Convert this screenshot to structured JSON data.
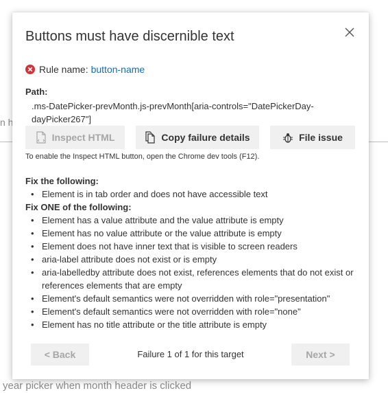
{
  "background": {
    "left_fragment": "n h",
    "bottom_text": "year picker when month header is clicked"
  },
  "dialog": {
    "title": "Buttons must have discernible text",
    "rule_label": "Rule name:",
    "rule_name": "button-name",
    "path_label": "Path:",
    "path_value": ".ms-DatePicker-prevMonth.js-prevMonth[aria-controls=\"DatePickerDay-dayPicker267\"]",
    "buttons": {
      "inspect": "Inspect HTML",
      "copy": "Copy failure details",
      "file": "File issue"
    },
    "hint": "To enable the Inspect HTML button, open the Chrome dev tools (F12).",
    "fix_all_heading": "Fix the following:",
    "fix_all_items": [
      "Element is in tab order and does not have accessible text"
    ],
    "fix_one_heading": "Fix ONE of the following:",
    "fix_one_items": [
      "Element has a value attribute and the value attribute is empty",
      "Element has no value attribute or the value attribute is empty",
      "Element does not have inner text that is visible to screen readers",
      "aria-label attribute does not exist or is empty",
      "aria-labelledby attribute does not exist, references elements that do not exist or references elements that are empty",
      "Element's default semantics were not overridden with role=\"presentation\"",
      "Element's default semantics were not overridden with role=\"none\"",
      "Element has no title attribute or the title attribute is empty"
    ],
    "footer": {
      "back": "< Back",
      "next": "Next >",
      "failure_count": "Failure 1 of 1 for this target"
    }
  },
  "colors": {
    "link": "#106ebe",
    "error": "#d13438",
    "button_bg": "#f0f0f0",
    "disabled_text": "#a6a6a6"
  },
  "icons": {
    "close": "close-icon",
    "error": "error-circle-icon",
    "inspect": "inspect-file-icon",
    "copy": "copy-icon",
    "file": "bug-icon"
  }
}
